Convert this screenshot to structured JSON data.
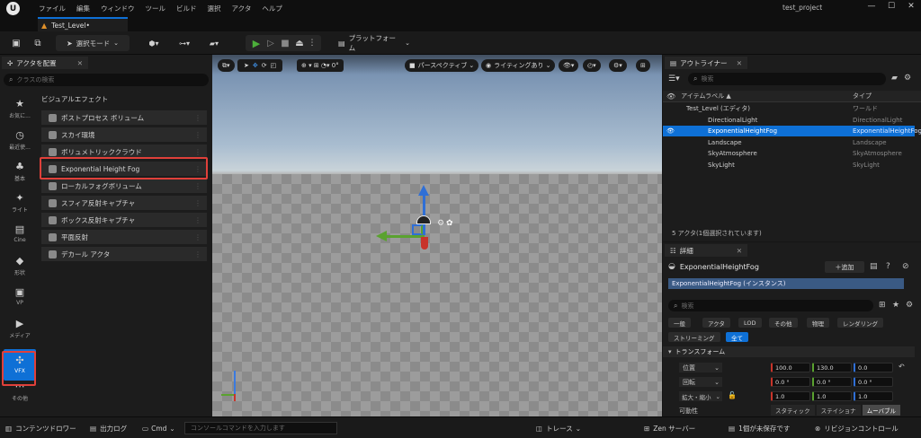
{
  "menu": [
    "ファイル",
    "編集",
    "ウィンドウ",
    "ツール",
    "ビルド",
    "選択",
    "アクタ",
    "ヘルプ"
  ],
  "project_name": "test_project",
  "level_tab": "Test_Level•",
  "toolbar": {
    "select_mode": "選択モード",
    "platform": "プラットフォーム"
  },
  "place_actors": {
    "tab": "アクタを配置",
    "search_placeholder": "クラスの検索",
    "section": "ビジュアルエフェクト",
    "categories": [
      {
        "label": "お気に...",
        "icon": "★"
      },
      {
        "label": "最近使...",
        "icon": "◷"
      },
      {
        "label": "基本",
        "icon": "♣"
      },
      {
        "label": "ライト",
        "icon": "✦"
      },
      {
        "label": "Cine",
        "icon": "▤"
      },
      {
        "label": "形状",
        "icon": "◆"
      },
      {
        "label": "VP",
        "icon": "▣"
      },
      {
        "label": "メディア",
        "icon": "▶"
      },
      {
        "label": "VFX",
        "icon": "✣"
      },
      {
        "label": "その他",
        "icon": "⋯"
      }
    ],
    "items": [
      "ポストプロセス ボリューム",
      "スカイ環境",
      "ボリュメトリッククラウド",
      "Exponential Height Fog",
      "ローカルフォグボリューム",
      "スフィア反射キャプチャ",
      "ボックス反射キャプチャ",
      "平面反射",
      "デカール アクタ"
    ]
  },
  "viewport": {
    "perspective": "パースペクティブ",
    "lighting": "ライティングあり",
    "angle": "0°"
  },
  "outliner": {
    "tab": "アウトライナー",
    "search_placeholder": "検索",
    "col_label": "アイテムラベル ▲",
    "col_type": "タイプ",
    "rows": [
      {
        "name": "Test_Level (エディタ)",
        "type": "ワールド"
      },
      {
        "name": "DirectionalLight",
        "type": "DirectionalLight"
      },
      {
        "name": "ExponentialHeightFog",
        "type": "ExponentialHeightFog"
      },
      {
        "name": "Landscape",
        "type": "Landscape"
      },
      {
        "name": "SkyAtmosphere",
        "type": "SkyAtmosphere"
      },
      {
        "name": "SkyLight",
        "type": "SkyLight"
      }
    ],
    "footer": "5 アクタ(1個選択されています)"
  },
  "details": {
    "tab": "詳細",
    "actor": "ExponentialHeightFog",
    "add_button": "＋追加",
    "instance": "ExponentialHeightFog (インスタンス)",
    "search_placeholder": "検索",
    "filters": [
      "一般",
      "アクタ",
      "LOD",
      "その他",
      "物理",
      "レンダリング",
      "ストリーミング",
      "全て"
    ],
    "section": "トランスフォーム",
    "location": {
      "label": "位置",
      "x": "100.0",
      "y": "130.0",
      "z": "0.0"
    },
    "rotation": {
      "label": "回転",
      "x": "0.0 °",
      "y": "0.0 °",
      "z": "0.0 °"
    },
    "scale": {
      "label": "拡大・縮小",
      "x": "1.0",
      "y": "1.0",
      "z": "1.0"
    },
    "mobility": {
      "label": "可動性",
      "options": [
        "スタティック",
        "ステイショナ",
        "ムーバブル"
      ]
    }
  },
  "status": {
    "content_drawer": "コンテンツドロワー",
    "output_log": "出力ログ",
    "cmd": "Cmd",
    "console_placeholder": "コンソールコマンドを入力します",
    "trace": "トレース",
    "zen": "Zen サーバー",
    "unsaved": "1個が未保存です",
    "revision": "リビジョンコントロール"
  },
  "colors": {
    "accent": "#0e70d6",
    "highlight": "#e0403a",
    "play": "#4caf3a"
  }
}
